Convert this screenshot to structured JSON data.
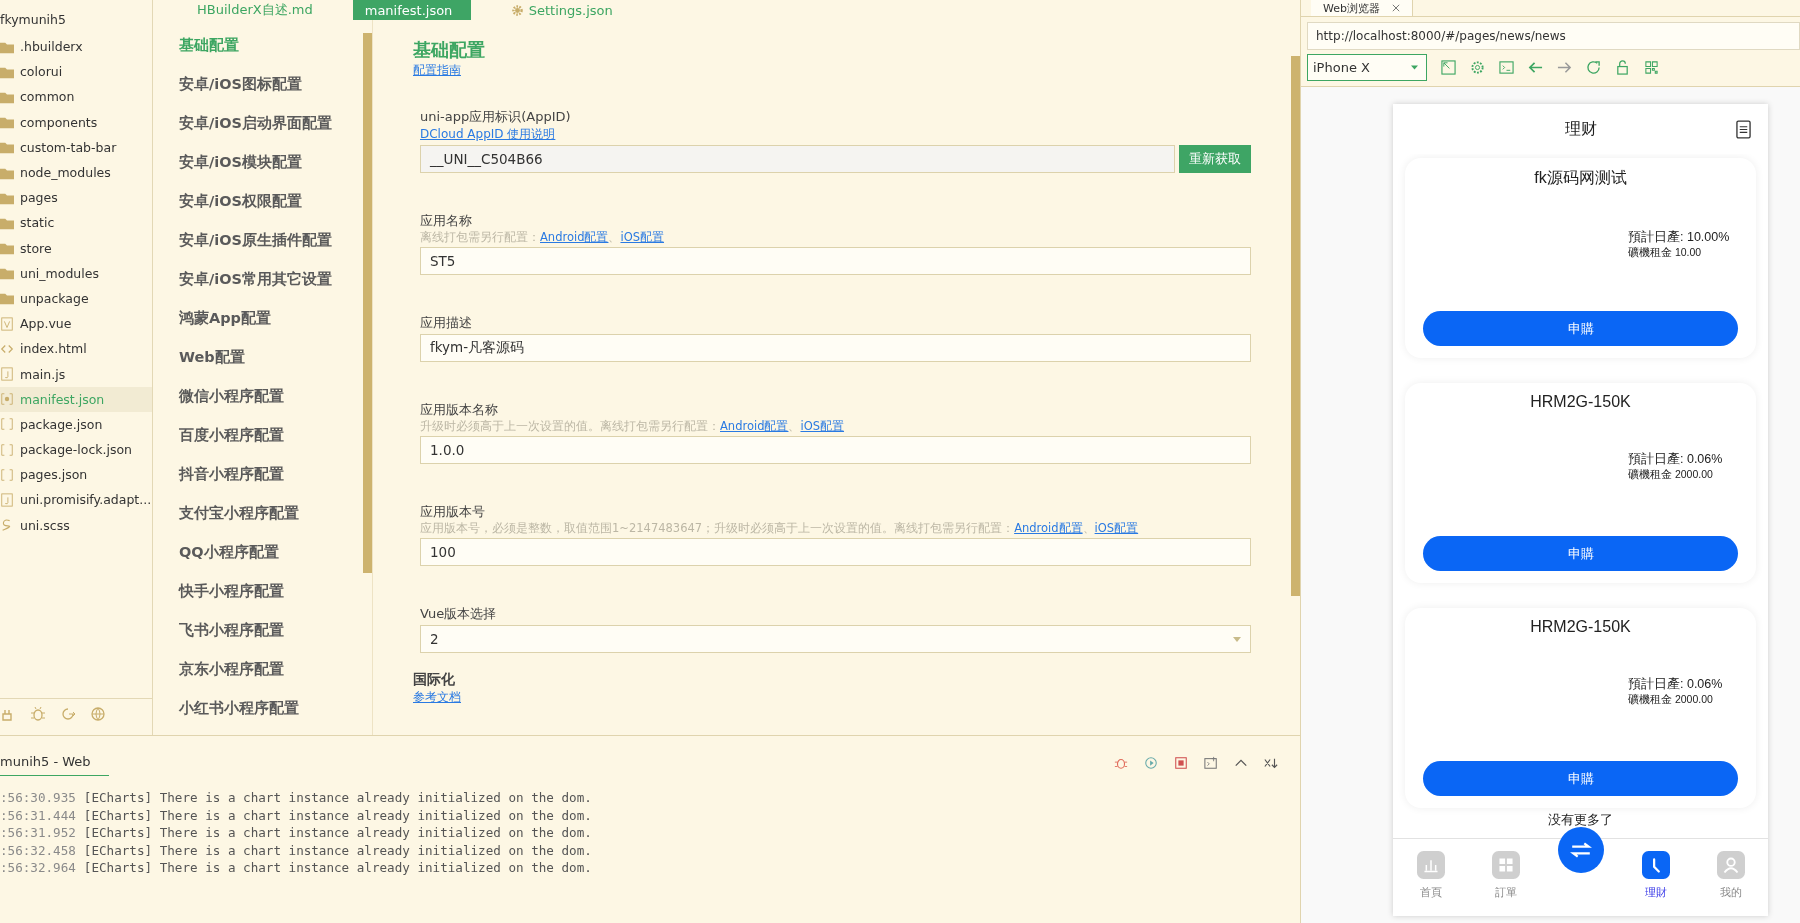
{
  "file_tree": {
    "root": "fkymunih5",
    "items": [
      {
        "name": ".hbuilderx",
        "kind": "folder",
        "selected": false
      },
      {
        "name": "colorui",
        "kind": "folder",
        "selected": false
      },
      {
        "name": "common",
        "kind": "folder",
        "selected": false
      },
      {
        "name": "components",
        "kind": "folder",
        "selected": false
      },
      {
        "name": "custom-tab-bar",
        "kind": "folder",
        "selected": false
      },
      {
        "name": "node_modules",
        "kind": "folder",
        "selected": false
      },
      {
        "name": "pages",
        "kind": "folder",
        "selected": false
      },
      {
        "name": "static",
        "kind": "folder",
        "selected": false
      },
      {
        "name": "store",
        "kind": "folder",
        "selected": false
      },
      {
        "name": "uni_modules",
        "kind": "folder",
        "selected": false
      },
      {
        "name": "unpackage",
        "kind": "folder",
        "selected": false
      },
      {
        "name": "App.vue",
        "kind": "vue",
        "selected": false
      },
      {
        "name": "index.html",
        "kind": "html",
        "selected": false
      },
      {
        "name": "main.js",
        "kind": "js",
        "selected": false
      },
      {
        "name": "manifest.json",
        "kind": "manifest",
        "selected": true
      },
      {
        "name": "package.json",
        "kind": "json",
        "selected": false
      },
      {
        "name": "package-lock.json",
        "kind": "json",
        "selected": false
      },
      {
        "name": "pages.json",
        "kind": "json",
        "selected": false
      },
      {
        "name": "uni.promisify.adapt...",
        "kind": "js",
        "selected": false
      },
      {
        "name": "uni.scss",
        "kind": "scss",
        "selected": false
      }
    ]
  },
  "editor_tabs": [
    {
      "label": "HBuilderX自述.md",
      "kind": "text",
      "selected": false
    },
    {
      "label": "manifest.json",
      "kind": "text",
      "selected": true
    },
    {
      "label": "Settings.json",
      "kind": "settings",
      "selected": false
    }
  ],
  "settings_nav": [
    {
      "label": "基础配置",
      "selected": true
    },
    {
      "label": "安卓/iOS图标配置",
      "selected": false
    },
    {
      "label": "安卓/iOS启动界面配置",
      "selected": false
    },
    {
      "label": "安卓/iOS模块配置",
      "selected": false
    },
    {
      "label": "安卓/iOS权限配置",
      "selected": false
    },
    {
      "label": "安卓/iOS原生插件配置",
      "selected": false
    },
    {
      "label": "安卓/iOS常用其它设置",
      "selected": false
    },
    {
      "label": "鸿蒙App配置",
      "selected": false
    },
    {
      "label": "Web配置",
      "selected": false
    },
    {
      "label": "微信小程序配置",
      "selected": false
    },
    {
      "label": "百度小程序配置",
      "selected": false
    },
    {
      "label": "抖音小程序配置",
      "selected": false
    },
    {
      "label": "支付宝小程序配置",
      "selected": false
    },
    {
      "label": "QQ小程序配置",
      "selected": false
    },
    {
      "label": "快手小程序配置",
      "selected": false
    },
    {
      "label": "飞书小程序配置",
      "selected": false
    },
    {
      "label": "京东小程序配置",
      "selected": false
    },
    {
      "label": "小红书小程序配置",
      "selected": false
    }
  ],
  "form": {
    "title": "基础配置",
    "guide_link": "配置指南",
    "fields": [
      {
        "kind": "readonly",
        "label": "uni-app应用标识(AppID)",
        "link": "DCloud AppID 使用说明",
        "value": "__UNI__C504B66",
        "button": "重新获取"
      },
      {
        "kind": "input",
        "label": "应用名称",
        "hint": "离线打包需另行配置：",
        "links": [
          "Android配置",
          "iOS配置"
        ],
        "separator": "、",
        "value": "ST5"
      },
      {
        "kind": "input",
        "label": "应用描述",
        "value": "fkym-凡客源码"
      },
      {
        "kind": "input",
        "label": "应用版本名称",
        "hint": "升级时必须高于上一次设置的值。离线打包需另行配置：",
        "links": [
          "Android配置",
          "iOS配置"
        ],
        "separator": "、",
        "value": "1.0.0"
      },
      {
        "kind": "input",
        "label": "应用版本号",
        "hint": "应用版本号，必须是整数，取值范围1~2147483647；升级时必须高于上一次设置的值。离线打包需另行配置：",
        "links": [
          "Android配置",
          "iOS配置"
        ],
        "separator": "、",
        "value": "100"
      },
      {
        "kind": "select",
        "label": "Vue版本选择",
        "value": "2"
      }
    ],
    "section": {
      "title": "国际化",
      "link": "参考文档"
    }
  },
  "console": {
    "tab": "munih5 - Web",
    "lines": [
      {
        "time": ":56:30.935",
        "message": "[ECharts] There is a chart instance already initialized on the dom."
      },
      {
        "time": ":56:31.444",
        "message": "[ECharts] There is a chart instance already initialized on the dom."
      },
      {
        "time": ":56:31.952",
        "message": "[ECharts] There is a chart instance already initialized on the dom."
      },
      {
        "time": ":56:32.458",
        "message": "[ECharts] There is a chart instance already initialized on the dom."
      },
      {
        "time": ":56:32.964",
        "message": "[ECharts] There is a chart instance already initialized on the dom."
      }
    ]
  },
  "browser": {
    "tab": "Web浏览器",
    "url": "http://localhost:8000/#/pages/news/news",
    "device": "iPhone X",
    "phone": {
      "title": "理财",
      "cards": [
        {
          "name": "fk源码网测试",
          "rate": "預計日產: 10.00%",
          "rent": "礦機租金 10.00",
          "button": "申購"
        },
        {
          "name": "HRM2G-150K",
          "rate": "預計日產: 0.06%",
          "rent": "礦機租金 2000.00",
          "button": "申購"
        },
        {
          "name": "HRM2G-150K",
          "rate": "預計日產: 0.06%",
          "rent": "礦機租金 2000.00",
          "button": "申購"
        }
      ],
      "footer": "没有更多了",
      "tabs": [
        {
          "kind": "chart",
          "label": "首頁",
          "selected": false
        },
        {
          "kind": "grid",
          "label": "訂單",
          "selected": false
        },
        {
          "kind": "center"
        },
        {
          "kind": "clock",
          "label": "理財",
          "selected": true
        },
        {
          "kind": "user",
          "label": "我的",
          "selected": false
        }
      ]
    }
  }
}
